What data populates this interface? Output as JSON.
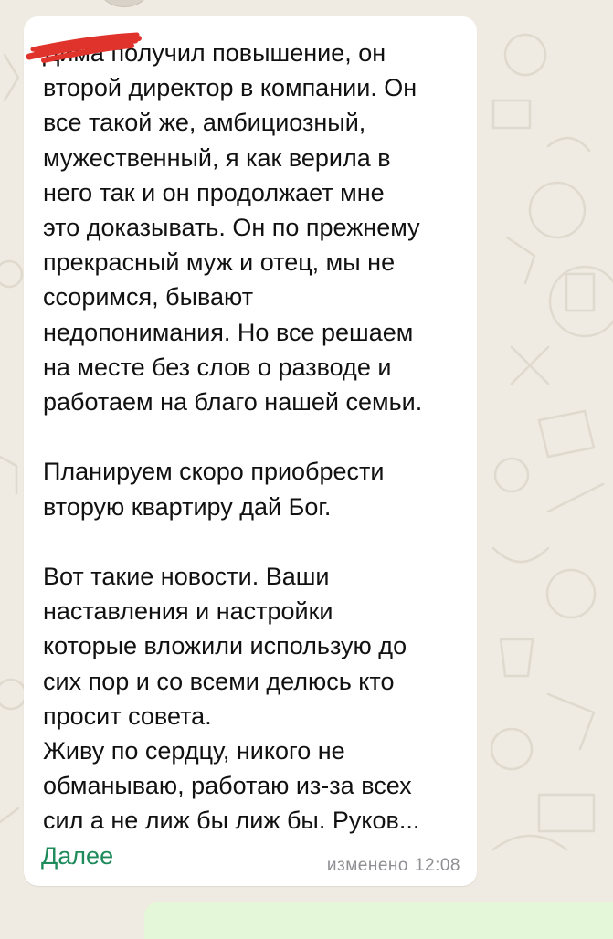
{
  "message": {
    "text": "Дима получил повышение, он\nвторой директор в компании. Он\nвсе такой же, амбициозный,\nмужественный, я как верила в\nнего так и он продолжает мне\nэто доказывать. Он по прежнему\nпрекрасный муж и отец, мы не\nссоримся, бывают\nнедопонимания. Но все решаем\nна месте без слов о разводе и\nработаем на благо нашей семьи.\n\nПланируем скоро приобрести\nвторую квартиру дай Бог.\n\nВот такие новости. Ваши\nнаставления и настройки\nкоторые вложили использую до\nсих пор и со всеми делюсь кто\nпросит совета.\nЖиву по сердцу, никого не\nобманываю, работаю из-за всех\nсил а не лиж бы лиж бы. Руков...",
    "more_label": "Далее",
    "edited_label": "изменено",
    "time": "12:08"
  },
  "colors": {
    "background": "#efeae2",
    "bubble_incoming": "#ffffff",
    "bubble_outgoing": "#e4f7d8",
    "link": "#1f8a5b",
    "meta": "#8e8e93",
    "redaction": "#e0332b"
  }
}
